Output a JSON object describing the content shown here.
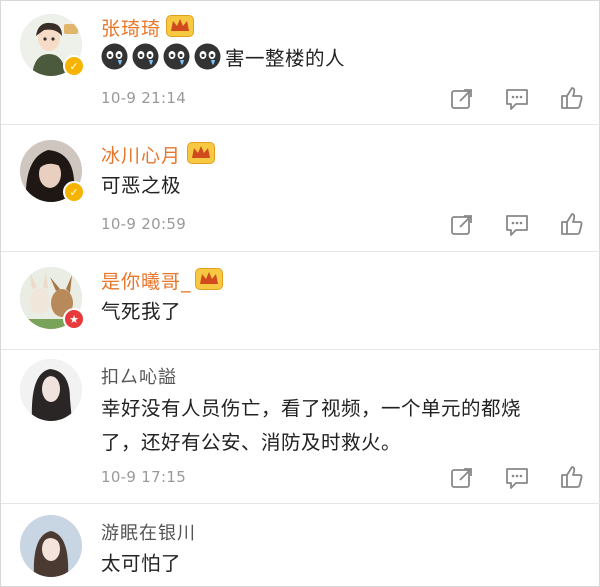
{
  "comments": [
    {
      "username": "张琦琦",
      "text_suffix": "害一整楼的人",
      "emoji_count": 4,
      "emoji_icon": "crying-face-icon",
      "time": "10-9  21:14",
      "vip": true,
      "badge": "verified-gold"
    },
    {
      "username": "冰川心月",
      "text": "可恶之极",
      "time": "10-9  20:59",
      "vip": true,
      "badge": "verified-gold"
    },
    {
      "username": "是你曦哥_",
      "text": "气死我了",
      "vip": true,
      "badge": "verified-red"
    },
    {
      "username": "扣厶吣謚",
      "text_lines": [
        "幸好没有人员伤亡，看了视频，一个单元的都烧",
        "了，还好有公安、消防及时救火。"
      ],
      "time": "10-9  17:15",
      "vip": false
    },
    {
      "username": "游眠在银川",
      "text": "太可怕了",
      "vip": false
    }
  ],
  "actions": [
    "share-icon",
    "reply-icon",
    "like-icon"
  ],
  "colors": {
    "vip_name": "#e8762b",
    "plain_name": "#555555",
    "time": "#999999",
    "badge_gold": "#f6b400",
    "badge_red": "#e8393b"
  }
}
